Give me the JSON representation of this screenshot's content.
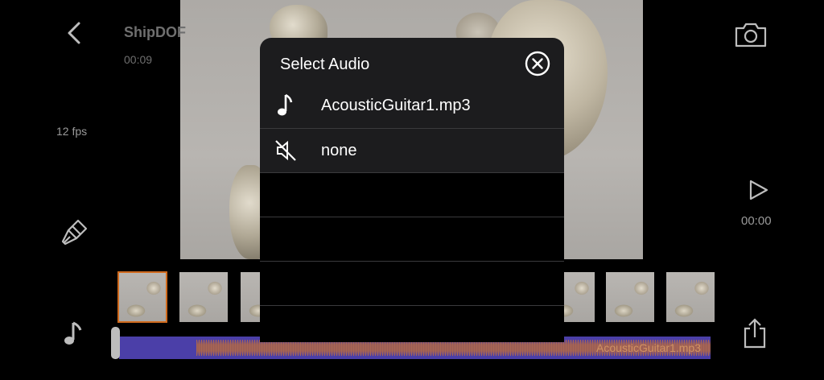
{
  "header": {
    "title": "ShipDOF",
    "duration": "00:09",
    "fps": "12 fps"
  },
  "player": {
    "time": "00:00"
  },
  "audio_track": {
    "label": "AcousticGuitar1.mp3"
  },
  "modal": {
    "title": "Select Audio",
    "options": [
      {
        "label": "AcousticGuitar1.mp3",
        "icon": "music-note-icon"
      },
      {
        "label": "none",
        "icon": "muted-speaker-icon"
      }
    ]
  },
  "colors": {
    "accent": "#d06a1d",
    "waveform_bg": "#4b3fa8",
    "modal_bg": "#1c1c1e"
  }
}
